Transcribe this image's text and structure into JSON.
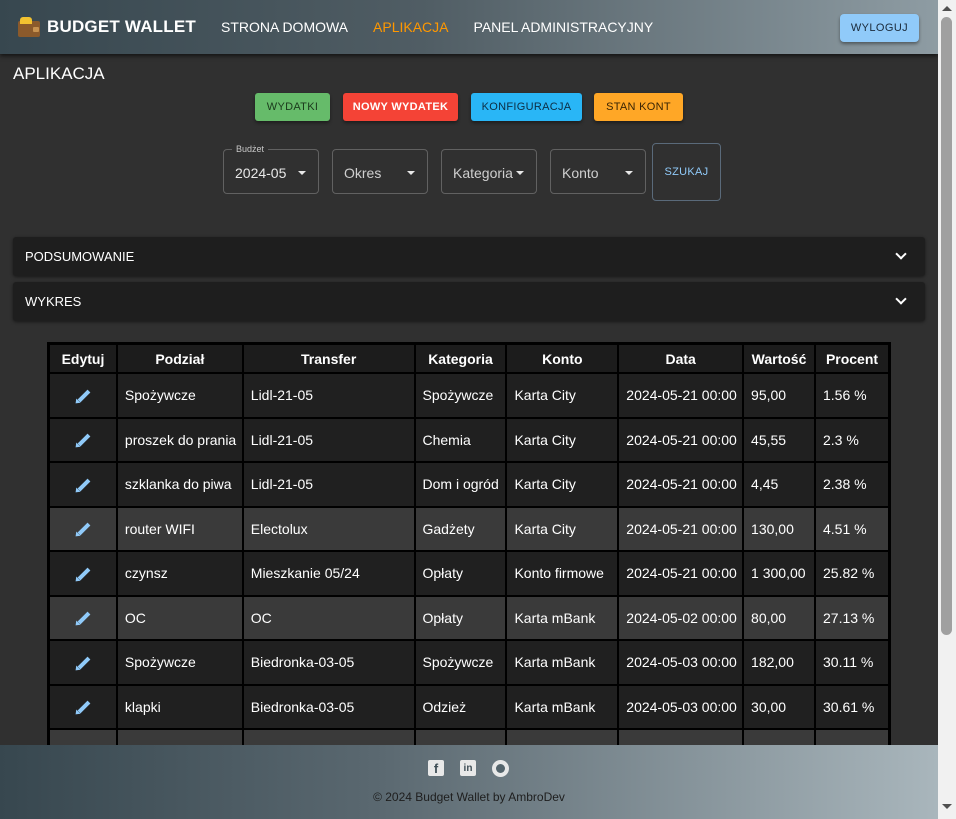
{
  "navbar": {
    "brand": "BUDGET WALLET",
    "links": [
      {
        "label": "STRONA DOMOWA"
      },
      {
        "label": "APLIKACJA"
      },
      {
        "label": "PANEL ADMINISTRACYJNY"
      }
    ],
    "logout": "WYLOGUJ",
    "active_color": "#ff9800"
  },
  "page": {
    "title": "APLIKACJA"
  },
  "actions": {
    "wydatki": "WYDATKI",
    "nowy": "NOWY WYDATEK",
    "konfiguracja": "KONFIGURACJA",
    "stan": "STAN KONT"
  },
  "filters": {
    "budzet": {
      "legend": "Budżet",
      "value": "2024-05"
    },
    "okres": {
      "value": "Okres"
    },
    "kategoria": {
      "value": "Kategoria"
    },
    "konto": {
      "value": "Konto"
    },
    "search": "SZUKAJ"
  },
  "accordions": {
    "summary": "PODSUMOWANIE",
    "chart": "WYKRES"
  },
  "table": {
    "headers": [
      "Edytuj",
      "Podział",
      "Transfer",
      "Kategoria",
      "Konto",
      "Data",
      "Wartość",
      "Procent"
    ],
    "rows": [
      {
        "podzial": "Spożywcze",
        "transfer": "Lidl-21-05",
        "kategoria": "Spożywcze",
        "konto": "Karta City",
        "data": "2024-05-21 00:00",
        "wartosc": "95,00",
        "procent": "1.56 %"
      },
      {
        "podzial": "proszek do prania",
        "transfer": "Lidl-21-05",
        "kategoria": "Chemia",
        "konto": "Karta City",
        "data": "2024-05-21 00:00",
        "wartosc": "45,55",
        "procent": "2.3 %"
      },
      {
        "podzial": "szklanka do piwa",
        "transfer": "Lidl-21-05",
        "kategoria": "Dom i ogród",
        "konto": "Karta City",
        "data": "2024-05-21 00:00",
        "wartosc": "4,45",
        "procent": "2.38 %"
      },
      {
        "podzial": "router WIFI",
        "transfer": "Electolux",
        "kategoria": "Gadżety",
        "konto": "Karta City",
        "data": "2024-05-21 00:00",
        "wartosc": "130,00",
        "procent": "4.51 %"
      },
      {
        "podzial": "czynsz",
        "transfer": "Mieszkanie 05/24",
        "kategoria": "Opłaty",
        "konto": "Konto firmowe",
        "data": "2024-05-21 00:00",
        "wartosc": "1 300,00",
        "procent": "25.82 %"
      },
      {
        "podzial": "OC",
        "transfer": "OC",
        "kategoria": "Opłaty",
        "konto": "Karta mBank",
        "data": "2024-05-02 00:00",
        "wartosc": "80,00",
        "procent": "27.13 %"
      },
      {
        "podzial": "Spożywcze",
        "transfer": "Biedronka-03-05",
        "kategoria": "Spożywcze",
        "konto": "Karta mBank",
        "data": "2024-05-03 00:00",
        "wartosc": "182,00",
        "procent": "30.11 %"
      },
      {
        "podzial": "klapki",
        "transfer": "Biedronka-03-05",
        "kategoria": "Odzież",
        "konto": "Karta mBank",
        "data": "2024-05-03 00:00",
        "wartosc": "30,00",
        "procent": "30.61 %"
      },
      {
        "podzial": "",
        "transfer": "",
        "kategoria": "",
        "konto": "",
        "data": "",
        "wartosc": "",
        "procent": ""
      }
    ]
  },
  "footer": {
    "copyright": "© 2024 Budget Wallet by AmbroDev",
    "icons": [
      "facebook-icon",
      "linkedin-icon",
      "github-icon"
    ]
  }
}
